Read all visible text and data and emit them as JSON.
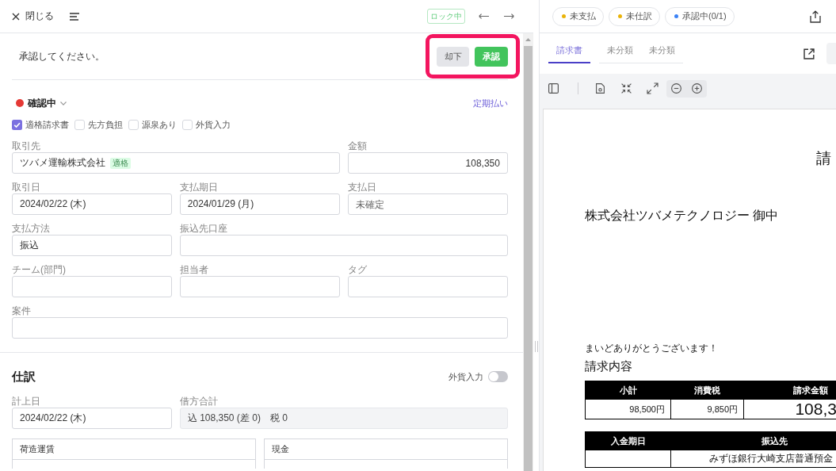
{
  "header": {
    "close_label": "閉じる",
    "lock_badge": "ロック中"
  },
  "approval": {
    "message": "承認してください。",
    "highlighted": true,
    "buttons": [
      {
        "label": "却下",
        "kind": "reject"
      },
      {
        "label": "承認",
        "kind": "approve"
      }
    ]
  },
  "status": {
    "label": "確認中",
    "color": "#e53935",
    "link": "定期払い"
  },
  "flags": [
    {
      "label": "適格請求書",
      "checked": true
    },
    {
      "label": "先方負担",
      "checked": false
    },
    {
      "label": "源泉あり",
      "checked": false
    },
    {
      "label": "外貨入力",
      "checked": false
    }
  ],
  "fields": [
    {
      "label": "取引先",
      "kind": "text",
      "value": "ツバメ運輸株式会社",
      "badge": "適格"
    },
    {
      "label": "金額",
      "kind": "amount",
      "value": "108,350"
    },
    {
      "label": "取引日",
      "kind": "text",
      "value": "2024/02/22 (木)"
    },
    {
      "label": "支払期日",
      "kind": "text",
      "value": "2024/01/29 (月)"
    },
    {
      "label": "支払日",
      "kind": "text",
      "placeholder": "未確定"
    },
    {
      "label": "支払方法",
      "kind": "text",
      "value": "振込"
    },
    {
      "label": "振込先口座",
      "kind": "text"
    },
    {
      "label": "チーム(部門)",
      "kind": "text"
    },
    {
      "label": "担当者",
      "kind": "text"
    },
    {
      "label": "タグ",
      "kind": "text"
    },
    {
      "label": "案件",
      "kind": "text"
    }
  ],
  "journal": {
    "title": "仕訳",
    "toggle": {
      "label": "外貨入力",
      "on": false
    },
    "fields": [
      {
        "label": "計上日",
        "value": "2024/02/22 (木)",
        "disabled": false
      },
      {
        "label": "借方合計",
        "value": "込 108,350 (差 0)　税 0",
        "disabled": true
      }
    ],
    "accounts": [
      "荷造運賃",
      "現金"
    ]
  },
  "document": {
    "status_chips": [
      {
        "label": "未支払",
        "color": "#eab308"
      },
      {
        "label": "未仕訳",
        "color": "#eab308"
      },
      {
        "label": "承認中(0/1)",
        "color": "#3b82f6"
      }
    ],
    "tabs": [
      {
        "label": "請求書",
        "selected": true
      },
      {
        "label": "未分類",
        "selected": false
      },
      {
        "label": "未分類",
        "selected": false
      }
    ],
    "invoice": {
      "title": "請",
      "recipient": "株式会社ツバメテクノロジー 御中",
      "greeting": "まいどありがとうございます！",
      "section": "請求内容",
      "summary": {
        "columns": [
          "小計",
          "消費税",
          "請求金額"
        ],
        "values": [
          "98,500円",
          "9,850円",
          "108,3"
        ]
      },
      "payment": {
        "columns": [
          "入金期日",
          "振込先"
        ],
        "transfer_to": "みずほ銀行大崎支店普通預金"
      }
    }
  }
}
